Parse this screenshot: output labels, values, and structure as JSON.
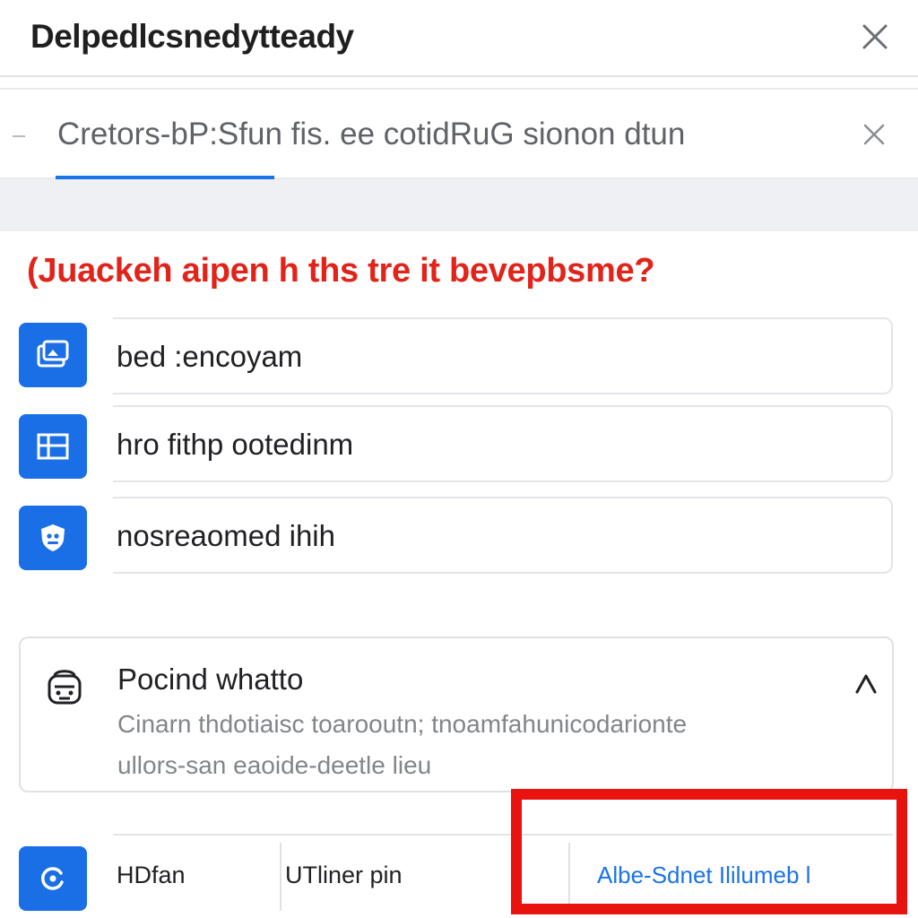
{
  "window": {
    "title": "Delpedlcsnedytteady",
    "close_icon": "close-icon"
  },
  "search_tab": {
    "label": "Cretors-bP:Sfun fis. ee cotidRuG sionon dtun",
    "close_icon": "close-icon",
    "accent": "#1a73e8"
  },
  "question": {
    "text": "(Juackeh aipen h ths tre it bevepbsme?",
    "color": "#e2231a"
  },
  "options": [
    {
      "label": "bed :encoyam",
      "icon": "folder-image-icon"
    },
    {
      "label": "hro fithp ootedinm",
      "icon": "list-icon"
    },
    {
      "label": "nosreaomed ihih",
      "icon": "shield-icon"
    }
  ],
  "info_card": {
    "title": "Pocind whatto",
    "line1": "Cinarn thdotiaisc toarooutn; tnoamfahunicodarionte",
    "line2": "ullors-san eaoide-deetle lieu",
    "icon": "robot-icon",
    "chevron_icon": "chevron-up-icon"
  },
  "bottom_row": {
    "icon": "refresh-icon",
    "cell1": "HDfan",
    "cell2": "UTliner pin",
    "link": "Albe-Sdnet Ililumeb l"
  },
  "colors": {
    "brand_blue": "#1a6fe6",
    "highlight_red": "#e8130e"
  }
}
